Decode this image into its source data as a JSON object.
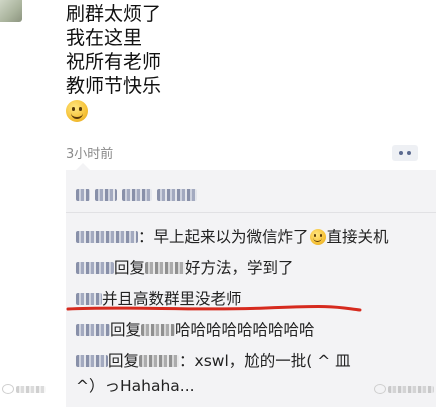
{
  "post": {
    "lines": [
      "刷群太烦了",
      "我在这里",
      "祝所有老师",
      "教师节快乐"
    ],
    "emoji": "smile-emoji"
  },
  "meta": {
    "timestamp": "3小时前"
  },
  "comments": {
    "c1_text": "：早上起来以为微信炸了",
    "c1_tail": "直接关机",
    "c2_reply": "回复",
    "c2_text": "好方法，学到了",
    "c3_text": "并且高数群里没老师",
    "c4_reply": "回复",
    "c4_text": "哈哈哈哈哈哈哈哈哈",
    "c5_reply": "回复",
    "c5_text": "：xswl，尬的一批( ^ 皿",
    "c5_cont": "^）っHahaha..."
  },
  "colors": {
    "underline": "#d62a1e",
    "comment_bg": "#f3f3f5",
    "timestamp": "#8a8a8a"
  }
}
